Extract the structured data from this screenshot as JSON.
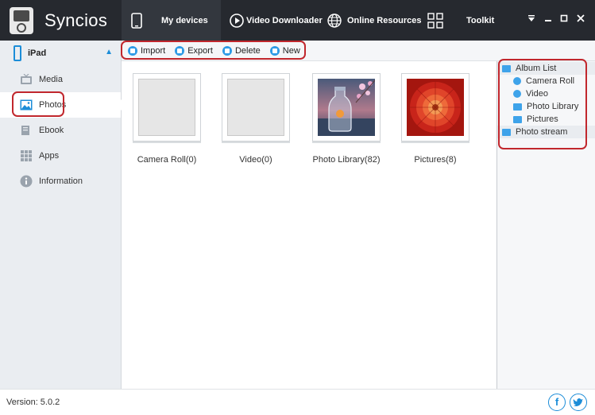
{
  "app": {
    "name": "Syncios"
  },
  "nav": {
    "my_devices": "My devices",
    "video_downloader": "Video Downloader",
    "online_resources": "Online Resources",
    "toolkit": "Toolkit"
  },
  "device": {
    "name": "iPad"
  },
  "sidebar": {
    "items": [
      {
        "label": "Media",
        "icon": "tv-icon"
      },
      {
        "label": "Photos",
        "icon": "photos-icon",
        "active": true
      },
      {
        "label": "Ebook",
        "icon": "book-icon"
      },
      {
        "label": "Apps",
        "icon": "apps-grid-icon"
      },
      {
        "label": "Information",
        "icon": "info-icon"
      }
    ]
  },
  "toolbar": {
    "import": "Import",
    "export": "Export",
    "delete": "Delete",
    "new": "New"
  },
  "albums": [
    {
      "label": "Camera Roll(0)"
    },
    {
      "label": "Video(0)"
    },
    {
      "label": "Photo Library(82)"
    },
    {
      "label": "Pictures(8)"
    }
  ],
  "album_tree": {
    "header": "Album List",
    "children": [
      "Camera Roll",
      "Video",
      "Photo Library",
      "Pictures"
    ],
    "photo_stream": "Photo stream"
  },
  "footer": {
    "version": "Version: 5.0.2"
  },
  "colors": {
    "accent": "#1c8dd8",
    "topbar": "#26292f",
    "highlight": "#c1272d"
  }
}
